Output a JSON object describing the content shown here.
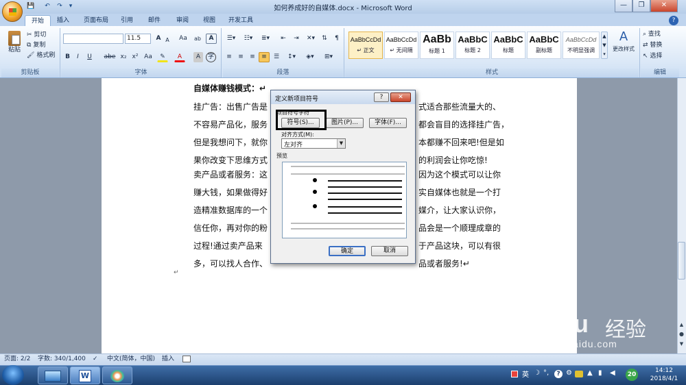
{
  "window": {
    "title": "如何养成好的自媒体.docx - Microsoft Word",
    "controls": [
      "—",
      "❐",
      "✕"
    ]
  },
  "quick_access": [
    "💾",
    "↶",
    "↷",
    "▾"
  ],
  "tabs": [
    "开始",
    "插入",
    "页面布局",
    "引用",
    "邮件",
    "审阅",
    "视图",
    "开发工具"
  ],
  "clipboard": {
    "paste": "粘贴",
    "cut": "剪切",
    "copy": "复制",
    "format_painter": "格式刷",
    "label": "剪贴板"
  },
  "font": {
    "name": "",
    "size": "11.5",
    "label": "字体",
    "buttons": [
      "B",
      "I",
      "U",
      "abe",
      "x₂",
      "x²",
      "Aa",
      "A",
      "A"
    ],
    "top_buttons": [
      "A",
      "A",
      "Aa",
      "ab",
      "wén",
      "A"
    ]
  },
  "paragraph": {
    "label": "段落"
  },
  "styles": {
    "label": "样式",
    "items": [
      {
        "sample": "AaBbCcDd",
        "name": "↵ 正文"
      },
      {
        "sample": "AaBbCcDd",
        "name": "↵ 无间隔"
      },
      {
        "sample": "AaBb",
        "name": "标题 1"
      },
      {
        "sample": "AaBbC",
        "name": "标题 2"
      },
      {
        "sample": "AaBbC",
        "name": "标题"
      },
      {
        "sample": "AaBbC",
        "name": "副标题"
      },
      {
        "sample": "AaBbCcDd",
        "name": "不明显强调"
      }
    ],
    "change_styles": "更改样式"
  },
  "editing": {
    "find": "查找",
    "replace": "替换",
    "select": "选择",
    "label": "编辑"
  },
  "document": {
    "lines": [
      "自媒体赚钱模式：↵",
      "挂广告：出售广告是",
      "不容易产品化，服务",
      "但是我想问下，就你",
      "果你改变下思维方式",
      "卖产品或者服务：这",
      "赚大钱，如果做得好",
      "造精准数据库的一个",
      "信任你，再对你的粉",
      "过程!通过卖产品来",
      "多，可以找人合作、"
    ],
    "lines_right": [
      "",
      "式适合那些流量大的、",
      "都会盲目的选择挂广告，",
      "本都赚不回来吧!但是如",
      "的利润会让你吃惊!",
      "因为这个模式可以让你",
      "实自媒体也就是一个打",
      "媒介，让大家认识你，",
      "品会是一个顺理成章的",
      "于产品这块，可以有很",
      "品或者服务!↵"
    ],
    "return_mark": "↵"
  },
  "dialog": {
    "title": "定义新项目符号",
    "help": "?",
    "close": "✕",
    "group_label": "项目符号字符",
    "btn_symbol": "符号(S)...",
    "btn_picture": "图片(P)...",
    "btn_font": "字体(F)...",
    "align_label": "对齐方式(M):",
    "align_value": "左对齐",
    "preview_label": "预览",
    "ok": "确定",
    "cancel": "取消"
  },
  "status": {
    "page": "页面: 2/2",
    "words": "字数: 340/1,400",
    "lang": "中文(简体，中国)",
    "mode": "插入"
  },
  "taskbar": {
    "ime": "英",
    "time": "14:12",
    "date": "2018/4/1",
    "badge": "20"
  },
  "watermark": {
    "logo": "Baidu",
    "cn": "经验",
    "url": "jingyan.baidu.com"
  }
}
